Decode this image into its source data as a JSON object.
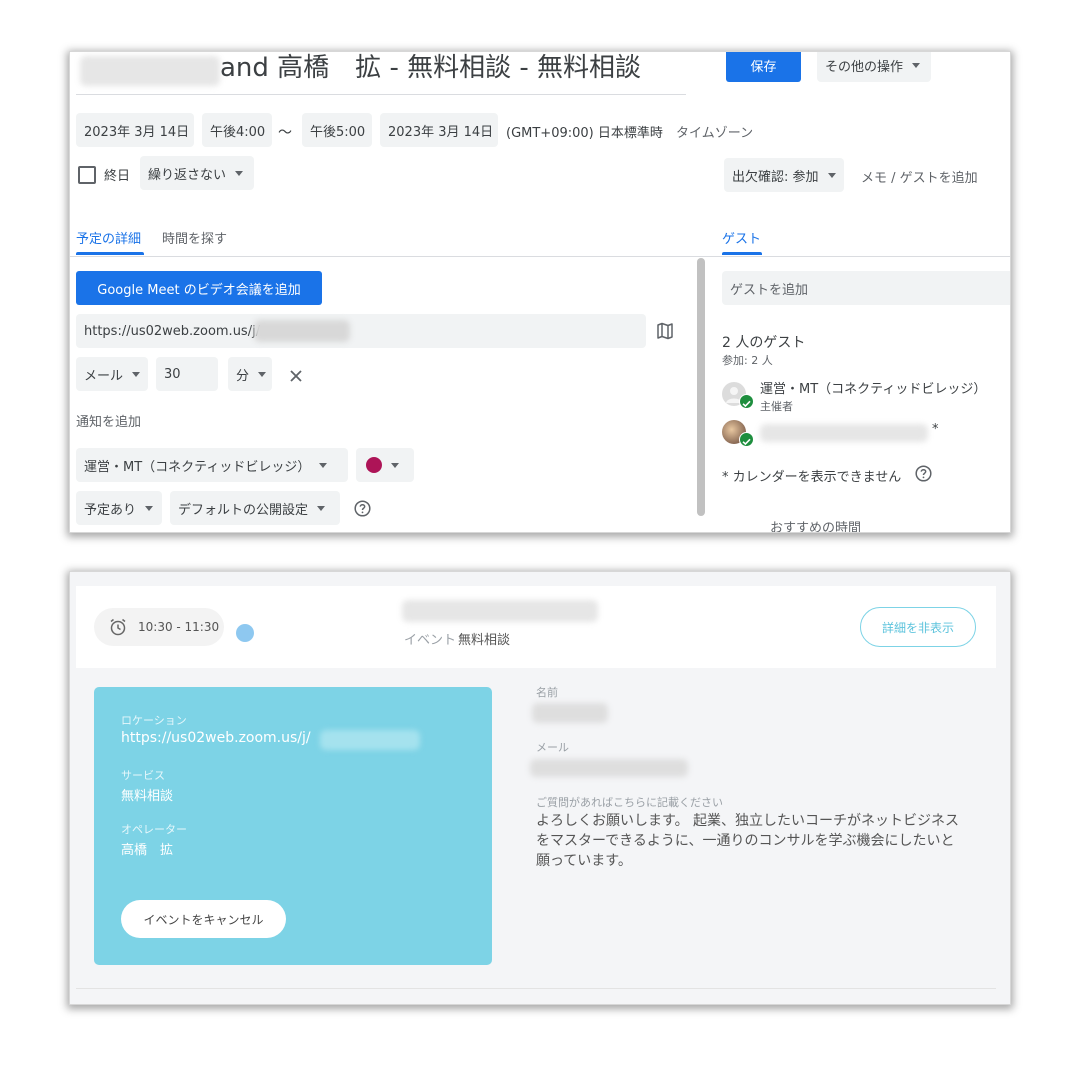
{
  "editor": {
    "title": "and 高橋　拡 - 無料相談 - 無料相談",
    "save_label": "保存",
    "more_actions_label": "その他の操作",
    "start_date": "2023年 3月 14日",
    "start_time": "午後4:00",
    "range_sep": "〜",
    "end_time": "午後5:00",
    "end_date": "2023年 3月 14日",
    "timezone_value": "(GMT+09:00) 日本標準時",
    "timezone_link": "タイムゾーン",
    "allday_label": "終日",
    "repeat_label": "繰り返さない",
    "rsvp_label": "出欠確認: 参加",
    "note_guest_label": "メモ / ゲストを追加",
    "tabs": {
      "details": "予定の詳細",
      "find_time": "時間を探す",
      "guests": "ゲスト"
    },
    "meet_button": "Google Meet のビデオ会議を追加",
    "location_value": "https://us02web.zoom.us/j/",
    "notify_type": "メール",
    "notify_value": "30",
    "notify_unit": "分",
    "add_notification": "通知を追加",
    "calendar_name": "運営・MT（コネクティッドビレッジ）",
    "calendar_color": "#ad1457",
    "availability": "予定あり",
    "visibility": "デフォルトの公開設定",
    "guest_input_placeholder": "ゲストを追加",
    "guest_count": "2 人のゲスト",
    "guest_attending": "参加: 2 人",
    "guest1_name": "運営・MT（コネクティッドビレッジ）",
    "guest1_role": "主催者",
    "guest2_suffix": "*",
    "calendar_notice": "* カレンダーを表示できません",
    "suggested_times": "おすすめの時間",
    "accent_color": "#1a73e8"
  },
  "booking": {
    "time_range": "10:30 - 11:30",
    "status_dot_color": "#8ec8f0",
    "event_label": "イベント",
    "event_name": "無料相談",
    "hide_details_label": "詳細を非表示",
    "card_color": "#7dd3e6",
    "location_label": "ロケーション",
    "location_value": "https://us02web.zoom.us/j/",
    "service_label": "サービス",
    "service_value": "無料相談",
    "operator_label": "オペレーター",
    "operator_value": "高橋　拡",
    "cancel_label": "イベントをキャンセル",
    "name_label": "名前",
    "email_label": "メール",
    "question_label": "ご質問があればこちらに記載ください",
    "question_line1": "よろしくお願いします。 起業、独立したいコーチがネットビジネス",
    "question_line2": "をマスターできるように、一通りのコンサルを学ぶ機会にしたいと",
    "question_line3": "願っています。"
  }
}
